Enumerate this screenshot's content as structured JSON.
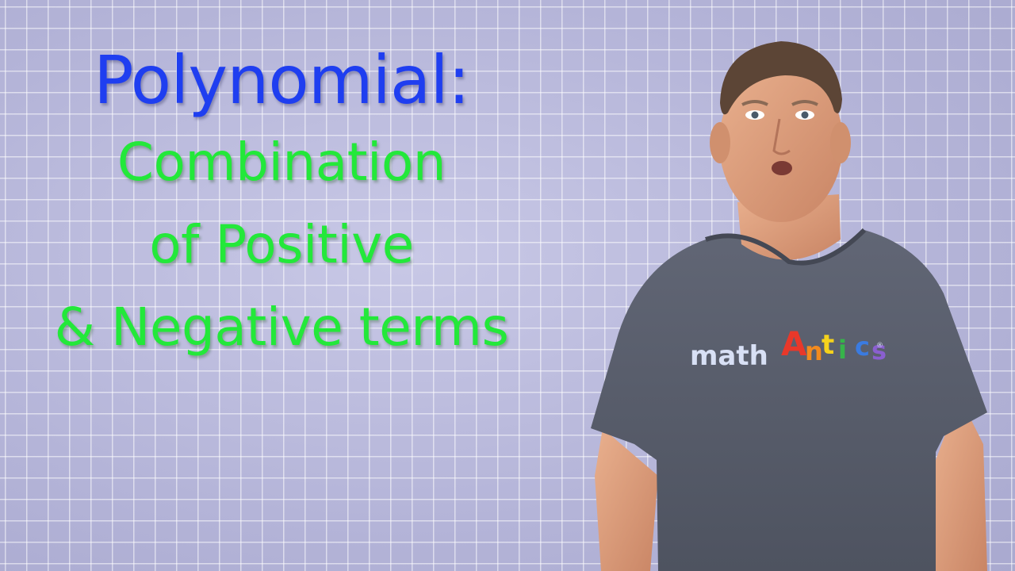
{
  "slide": {
    "heading": "Polynomial:",
    "definition_lines": [
      "Combination",
      "of Positive",
      "& Negative terms"
    ]
  },
  "shirt_logo": {
    "word1": "math",
    "word2_letters": [
      "A",
      "n",
      "t",
      "i",
      "c",
      "s"
    ],
    "word2_colors": [
      "#e8382a",
      "#f28a1e",
      "#f5d21c",
      "#36b44a",
      "#3a7be0",
      "#8a5fd0"
    ],
    "mark": "®"
  },
  "colors": {
    "heading": "#1f3ef0",
    "definition": "#23e83a",
    "background": "#b9b9dc",
    "shirt": "#5a5f6b"
  }
}
